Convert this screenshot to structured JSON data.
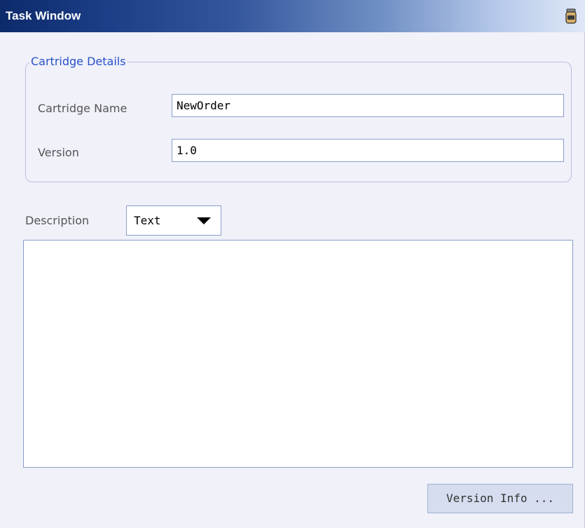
{
  "window": {
    "title": "Task Window",
    "title_icon": "canister-icon"
  },
  "cartridge_details": {
    "legend": "Cartridge Details",
    "name_label": "Cartridge Name",
    "name_value": "NewOrder",
    "version_label": "Version",
    "version_value": "1.0"
  },
  "description": {
    "label": "Description",
    "format_selected": "Text",
    "text": ""
  },
  "buttons": {
    "version_info_label": "Version Info ..."
  },
  "colors": {
    "legend_blue": "#2850c8",
    "title_dark": "#0d2a6b",
    "panel_bg": "#f0f1f9"
  }
}
